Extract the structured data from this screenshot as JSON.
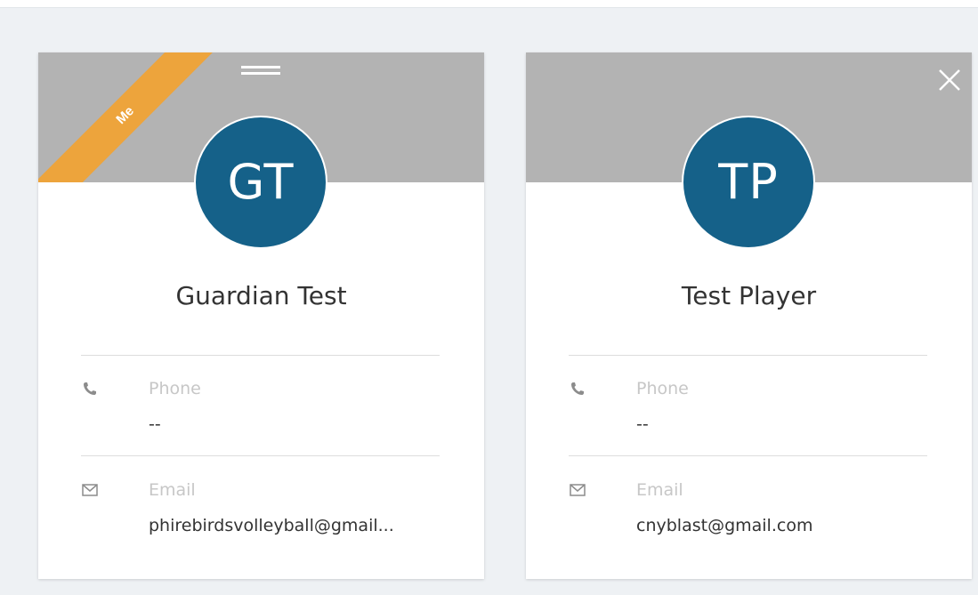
{
  "cards": [
    {
      "initials": "GT",
      "name": "Guardian Test",
      "badge": "Me",
      "phone_label": "Phone",
      "phone_value": "--",
      "email_label": "Email",
      "email_value": "phirebirdsvolleyball@gmail..."
    },
    {
      "initials": "TP",
      "name": "Test Player",
      "phone_label": "Phone",
      "phone_value": "--",
      "email_label": "Email",
      "email_value": "cnyblast@gmail.com"
    }
  ],
  "colors": {
    "page_background": "#eef1f4",
    "banner": "#b3b3b3",
    "avatar": "#156189",
    "me_badge": "#eda43c",
    "label_text": "#c7c7c7",
    "value_text": "#333333"
  },
  "icons": {
    "drag": "drag-handle-icon",
    "close": "close-icon",
    "phone": "phone-icon",
    "email": "envelope-icon"
  }
}
